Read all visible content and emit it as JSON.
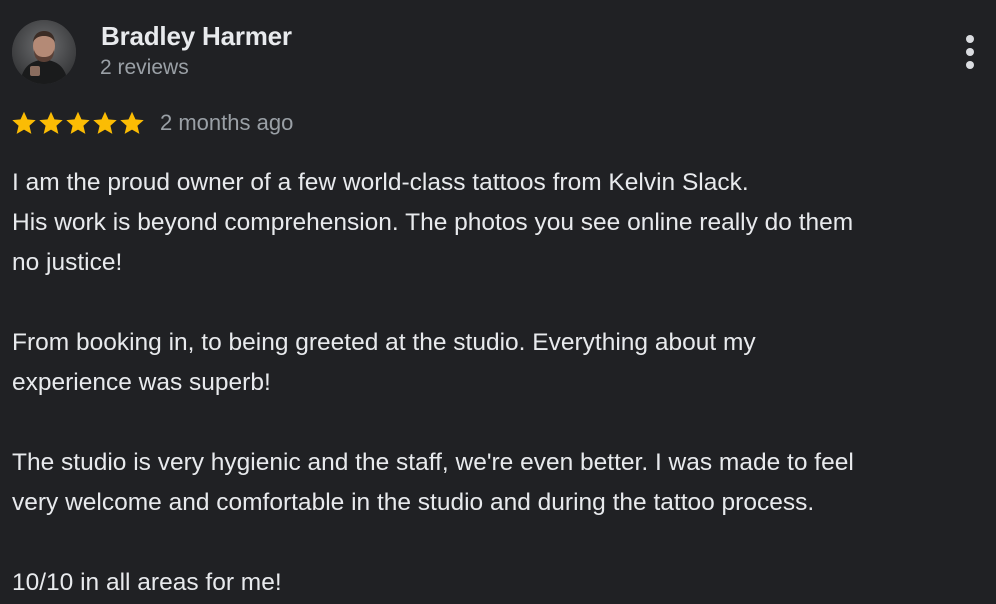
{
  "author": {
    "name": "Bradley Harmer",
    "review_count": "2 reviews",
    "avatar_icon": "user-avatar-photo"
  },
  "rating": {
    "stars": 5,
    "max_stars": 5,
    "star_color": "#fbbc04",
    "date": "2 months ago"
  },
  "menu": {
    "icon": "more-vert-icon"
  },
  "review": {
    "paragraphs": [
      {
        "lines": [
          "I am the proud owner of a few world-class tattoos from Kelvin Slack.",
          "His work is beyond comprehension. The photos you see online really do them",
          "no justice!"
        ]
      },
      {
        "lines": [
          "From booking in, to being greeted at the studio. Everything about my",
          "experience was superb!"
        ]
      },
      {
        "lines": [
          "The studio is very hygienic and the staff, we're even better. I was made to feel",
          "very welcome and comfortable in the studio and during the tattoo process."
        ]
      },
      {
        "lines": [
          "10/10 in all areas for me!"
        ]
      }
    ]
  },
  "colors": {
    "background": "#202124",
    "primary_text": "#e8eaed",
    "secondary_text": "#9aa0a6"
  }
}
